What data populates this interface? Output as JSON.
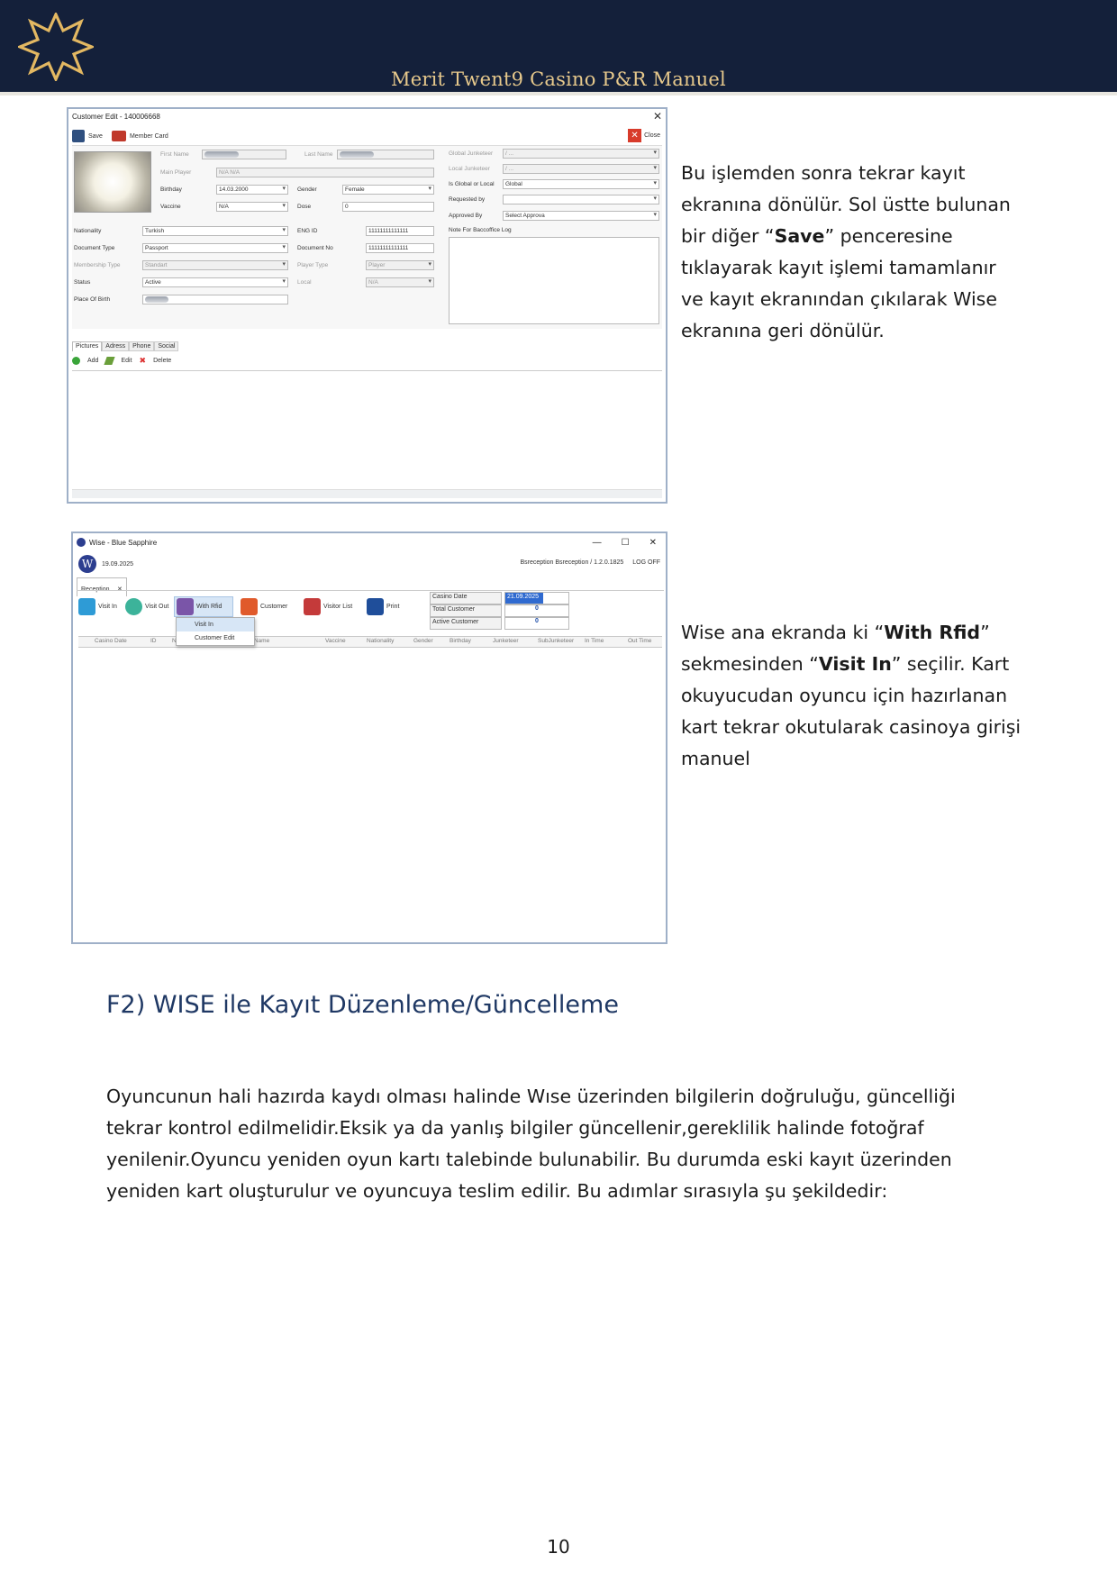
{
  "header": {
    "title": "Merit Twent9 Casino P&R Manuel",
    "colors": {
      "banner": "#14203a",
      "title": "#e7c98c",
      "logo": "#e3b862"
    }
  },
  "shot1": {
    "title": "Customer Edit - 140006668",
    "close_glyph": "✕",
    "toolbar": {
      "save": "Save",
      "member_card": "Member Card",
      "close": "Close"
    },
    "labels": {
      "first_name": "First Name",
      "last_name": "Last Name",
      "main_player": "Main Player",
      "birthday": "Birthday",
      "gender": "Gender",
      "vaccine": "Vaccine",
      "dose": "Dose",
      "nationality": "Nationality",
      "eng_id": "ENG ID",
      "document_type": "Document Type",
      "document_no": "Document No",
      "membership_type": "Membership Type",
      "player_type": "Player Type",
      "status": "Status",
      "local": "Local",
      "place_of_birth": "Place Of Birth",
      "global_junketeer": "Global Junketeer",
      "local_junketeer": "Local Junketeer",
      "is_global_or_local": "Is Global or Local",
      "requested_by": "Requested by",
      "approved_by": "Approved By",
      "note": "Note For Baccoffice Log"
    },
    "values": {
      "main_player": "N/A N/A",
      "birthday": "14.03.2000",
      "gender": "Female",
      "vaccine": "N/A",
      "dose": "0",
      "nationality": "Turkish",
      "eng_id": "11111111111111",
      "document_type": "Passport",
      "document_no": "11111111111111",
      "membership_type": "Standart",
      "player_type": "Player",
      "status": "Active",
      "local": "N/A",
      "global_junketeer": "/ ...",
      "local_junketeer": "/ ...",
      "is_global_or_local": "Global",
      "approved_by": "Select Approva"
    },
    "tabs": [
      "Pictures",
      "Adress",
      "Phone",
      "Social"
    ],
    "actions": {
      "add": "Add",
      "edit": "Edit",
      "delete": "Delete"
    }
  },
  "text1": {
    "part1": "Bu işlemden sonra tekrar kayıt ekranına dönülür. Sol üstte bulunan bir diğer “",
    "bold": "Save",
    "part2": "” penceresine tıklayarak kayıt işlemi tamamlanır ve kayıt ekranından çıkılarak Wise ekranına geri dönülür."
  },
  "shot2": {
    "title": "Wise - Blue Sapphire",
    "date": "19.09.2025",
    "user_info": "Bsreception Bsreception / 1.2.0.1825",
    "logout": "LOG OFF",
    "tab": "Reception",
    "tab_close": "✕",
    "window_controls": {
      "minimize": "—",
      "maximize": "☐",
      "close": "✕"
    },
    "toolbar": {
      "visit_in": "Visit In",
      "visit_out": "Visit Out",
      "with_rfid": "With Rfid",
      "customer": "Customer",
      "visitor_list": "Visitor List",
      "print": "Print"
    },
    "dropdown": [
      "Visit In",
      "Customer Edit"
    ],
    "stats": {
      "casino_date_label": "Casino Date",
      "casino_date_value": "21.09.2025",
      "total_customer_label": "Total Customer",
      "total_customer_value": "0",
      "active_customer_label": "Active Customer",
      "active_customer_value": "0"
    },
    "columns": [
      "Casino Date",
      "ID",
      "Na",
      "st Name",
      "Vaccine",
      "Nationality",
      "Gender",
      "Birthday",
      "Junketeer",
      "SubJunketeer",
      "In Time",
      "Out Time"
    ]
  },
  "text2": {
    "p1": "Wise ana ekranda ki “",
    "b1": "With Rfid",
    "p2": "” sekmesinden “",
    "b2": "Visit In",
    "p3": "” seçilir. Kart okuyucudan oyuncu için hazırlanan kart tekrar okutularak casinoya girişi manuel"
  },
  "section": {
    "heading": "F2) WISE ile Kayıt Düzenleme/Güncelleme",
    "body": "Oyuncunun hali hazırda kaydı olması halinde Wıse üzerinden bilgilerin doğruluğu, güncelliği tekrar kontrol edilmelidir.Eksik ya da yanlış bilgiler güncellenir,gereklilik halinde fotoğraf yenilenir.Oyuncu yeniden oyun kartı talebinde bulunabilir. Bu durumda eski kayıt üzerinden yeniden kart oluşturulur ve oyuncuya teslim edilir. Bu adımlar sırasıyla şu şekildedir:"
  },
  "page_number": "10"
}
